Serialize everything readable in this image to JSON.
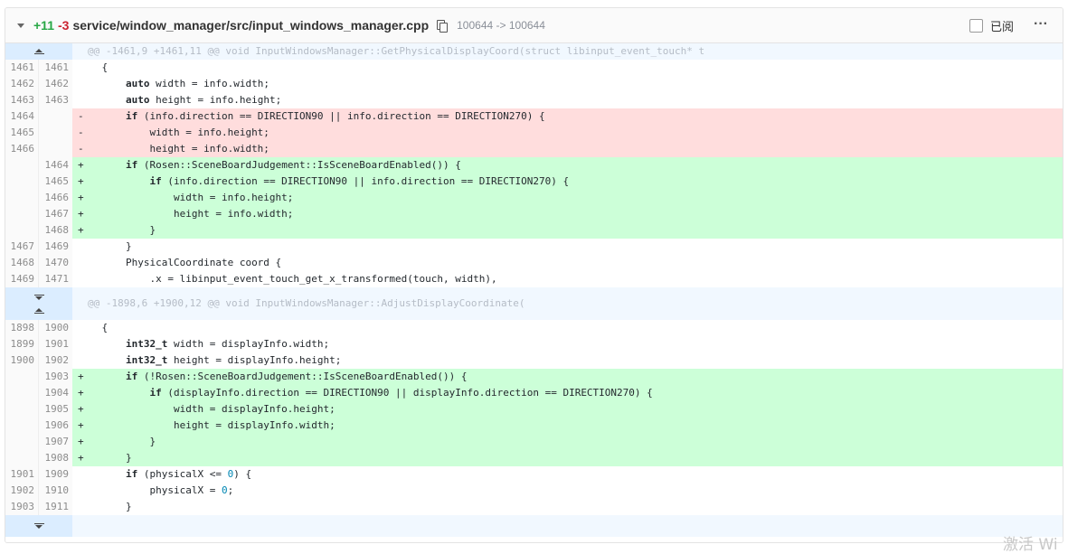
{
  "file": {
    "additions": "+11",
    "deletions": "-3",
    "path": "service/window_manager/src/input_windows_manager.cpp",
    "mode": "100644 -> 100644",
    "viewed_label": "已阅",
    "more": "···"
  },
  "hunks": [
    {
      "header": "@@ -1461,9 +1461,11 @@ void InputWindowsManager::GetPhysicalDisplayCoord(struct libinput_event_touch* t",
      "expand": "up",
      "lines": [
        {
          "type": "ctx",
          "old": "1461",
          "new": "1461",
          "sign": " ",
          "code": "{"
        },
        {
          "type": "ctx",
          "old": "1462",
          "new": "1462",
          "sign": " ",
          "code": "    auto width = info.width;"
        },
        {
          "type": "ctx",
          "old": "1463",
          "new": "1463",
          "sign": " ",
          "code": "    auto height = info.height;"
        },
        {
          "type": "del",
          "old": "1464",
          "new": "",
          "sign": "-",
          "code": "    if (info.direction == DIRECTION90 || info.direction == DIRECTION270) {"
        },
        {
          "type": "del",
          "old": "1465",
          "new": "",
          "sign": "-",
          "code": "        width = info.height;"
        },
        {
          "type": "del",
          "old": "1466",
          "new": "",
          "sign": "-",
          "code": "        height = info.width;"
        },
        {
          "type": "add",
          "old": "",
          "new": "1464",
          "sign": "+",
          "code": "    if (Rosen::SceneBoardJudgement::IsSceneBoardEnabled()) {"
        },
        {
          "type": "add",
          "old": "",
          "new": "1465",
          "sign": "+",
          "code": "        if (info.direction == DIRECTION90 || info.direction == DIRECTION270) {"
        },
        {
          "type": "add",
          "old": "",
          "new": "1466",
          "sign": "+",
          "code": "            width = info.height;"
        },
        {
          "type": "add",
          "old": "",
          "new": "1467",
          "sign": "+",
          "code": "            height = info.width;"
        },
        {
          "type": "add",
          "old": "",
          "new": "1468",
          "sign": "+",
          "code": "        }"
        },
        {
          "type": "ctx",
          "old": "1467",
          "new": "1469",
          "sign": " ",
          "code": "    }"
        },
        {
          "type": "ctx",
          "old": "1468",
          "new": "1470",
          "sign": " ",
          "code": "    PhysicalCoordinate coord {"
        },
        {
          "type": "ctx",
          "old": "1469",
          "new": "1471",
          "sign": " ",
          "code": "        .x = libinput_event_touch_get_x_transformed(touch, width),"
        }
      ]
    },
    {
      "header": "@@ -1898,6 +1900,12 @@ void InputWindowsManager::AdjustDisplayCoordinate(",
      "expand": "both",
      "lines": [
        {
          "type": "ctx",
          "old": "1898",
          "new": "1900",
          "sign": " ",
          "code": "{"
        },
        {
          "type": "ctx",
          "old": "1899",
          "new": "1901",
          "sign": " ",
          "code": "    int32_t width = displayInfo.width;"
        },
        {
          "type": "ctx",
          "old": "1900",
          "new": "1902",
          "sign": " ",
          "code": "    int32_t height = displayInfo.height;"
        },
        {
          "type": "add",
          "old": "",
          "new": "1903",
          "sign": "+",
          "code": "    if (!Rosen::SceneBoardJudgement::IsSceneBoardEnabled()) {"
        },
        {
          "type": "add",
          "old": "",
          "new": "1904",
          "sign": "+",
          "code": "        if (displayInfo.direction == DIRECTION90 || displayInfo.direction == DIRECTION270) {"
        },
        {
          "type": "add",
          "old": "",
          "new": "1905",
          "sign": "+",
          "code": "            width = displayInfo.height;"
        },
        {
          "type": "add",
          "old": "",
          "new": "1906",
          "sign": "+",
          "code": "            height = displayInfo.width;"
        },
        {
          "type": "add",
          "old": "",
          "new": "1907",
          "sign": "+",
          "code": "        }"
        },
        {
          "type": "add",
          "old": "",
          "new": "1908",
          "sign": "+",
          "code": "    }"
        },
        {
          "type": "ctx",
          "old": "1901",
          "new": "1909",
          "sign": " ",
          "code": "    if (physicalX <= 0) {"
        },
        {
          "type": "ctx",
          "old": "1902",
          "new": "1910",
          "sign": " ",
          "code": "        physicalX = 0;"
        },
        {
          "type": "ctx",
          "old": "1903",
          "new": "1911",
          "sign": " ",
          "code": "    }"
        }
      ]
    }
  ],
  "watermark": "激活 Wi",
  "colors": {
    "add_bg": "#ccffd8",
    "del_bg": "#ffdddd",
    "hunk_bg": "#f1f8ff",
    "additions": "#28a745",
    "deletions": "#cb2431"
  }
}
